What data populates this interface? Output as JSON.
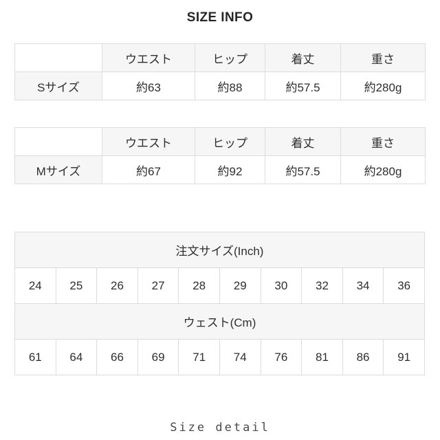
{
  "header": {
    "title": "SIZE INFO"
  },
  "spec_tables": [
    {
      "corner_label": "",
      "columns": [
        "ウエスト",
        "ヒップ",
        "着丈",
        "重さ"
      ],
      "row_label": "Sサイズ",
      "values": [
        "約63",
        "約88",
        "約57.5",
        "約280g"
      ]
    },
    {
      "corner_label": "",
      "columns": [
        "ウエスト",
        "ヒップ",
        "着丈",
        "重さ"
      ],
      "row_label": "Mサイズ",
      "values": [
        "約67",
        "約92",
        "約57.5",
        "約280g"
      ]
    }
  ],
  "order_table": {
    "inch_header": "注文サイズ(Inch)",
    "inch_values": [
      "24",
      "25",
      "26",
      "27",
      "28",
      "29",
      "30",
      "32",
      "34",
      "36"
    ],
    "cm_header": "ウェスト(Cm)",
    "cm_values": [
      "61",
      "64",
      "66",
      "69",
      "71",
      "74",
      "76",
      "81",
      "86",
      "91"
    ]
  },
  "footer": {
    "caption": "Size detail"
  },
  "colors": {
    "page_background": "#ffffff",
    "header_cell_background": "#f6f6f6",
    "value_cell_background": "#ffffff",
    "border": "#dcdcdc",
    "text": "#2e2e2e",
    "title_text": "#262626"
  }
}
